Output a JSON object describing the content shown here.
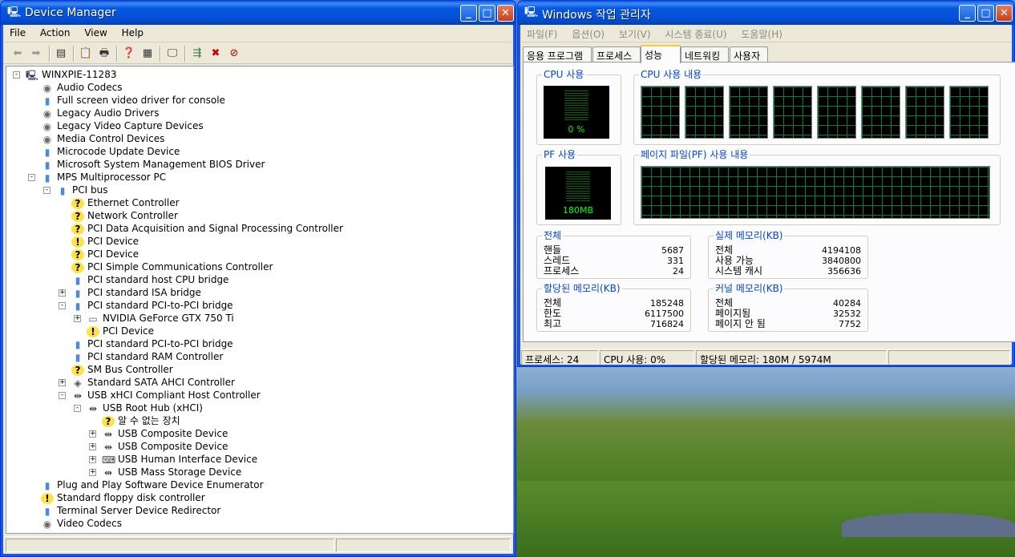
{
  "device_manager": {
    "title": "Device Manager",
    "menu": [
      "File",
      "Action",
      "View",
      "Help"
    ],
    "tree": [
      {
        "label": "WINXPIE-11283",
        "icon": "computer-icon",
        "depth": 0,
        "exp": "-"
      },
      {
        "label": "Audio Codecs",
        "icon": "codec-icon",
        "depth": 1,
        "exp": ""
      },
      {
        "label": "Full screen video driver for console",
        "icon": "device-icon",
        "depth": 1,
        "exp": ""
      },
      {
        "label": "Legacy Audio Drivers",
        "icon": "codec-icon",
        "depth": 1,
        "exp": ""
      },
      {
        "label": "Legacy Video Capture Devices",
        "icon": "codec-icon",
        "depth": 1,
        "exp": ""
      },
      {
        "label": "Media Control Devices",
        "icon": "codec-icon",
        "depth": 1,
        "exp": ""
      },
      {
        "label": "Microcode Update Device",
        "icon": "device-icon",
        "depth": 1,
        "exp": ""
      },
      {
        "label": "Microsoft System Management BIOS Driver",
        "icon": "device-icon",
        "depth": 1,
        "exp": ""
      },
      {
        "label": "MPS Multiprocessor PC",
        "icon": "device-icon",
        "depth": 1,
        "exp": "-"
      },
      {
        "label": "PCI bus",
        "icon": "device-icon",
        "depth": 2,
        "exp": "-"
      },
      {
        "label": "Ethernet Controller",
        "icon": "unknown-device-icon",
        "depth": 3,
        "exp": ""
      },
      {
        "label": "Network Controller",
        "icon": "unknown-device-icon",
        "depth": 3,
        "exp": ""
      },
      {
        "label": "PCI Data Acquisition and Signal Processing Controller",
        "icon": "unknown-device-icon",
        "depth": 3,
        "exp": ""
      },
      {
        "label": "PCI Device",
        "icon": "warning-device-icon",
        "depth": 3,
        "exp": ""
      },
      {
        "label": "PCI Device",
        "icon": "unknown-device-icon",
        "depth": 3,
        "exp": ""
      },
      {
        "label": "PCI Simple Communications Controller",
        "icon": "unknown-device-icon",
        "depth": 3,
        "exp": ""
      },
      {
        "label": "PCI standard host CPU bridge",
        "icon": "device-icon",
        "depth": 3,
        "exp": ""
      },
      {
        "label": "PCI standard ISA bridge",
        "icon": "device-icon",
        "depth": 3,
        "exp": "+"
      },
      {
        "label": "PCI standard PCI-to-PCI bridge",
        "icon": "device-icon",
        "depth": 3,
        "exp": "-"
      },
      {
        "label": "NVIDIA GeForce GTX 750 Ti",
        "icon": "display-icon",
        "depth": 4,
        "exp": "+"
      },
      {
        "label": "PCI Device",
        "icon": "warning-device-icon",
        "depth": 4,
        "exp": ""
      },
      {
        "label": "PCI standard PCI-to-PCI bridge",
        "icon": "device-icon",
        "depth": 3,
        "exp": ""
      },
      {
        "label": "PCI standard RAM Controller",
        "icon": "device-icon",
        "depth": 3,
        "exp": ""
      },
      {
        "label": "SM Bus Controller",
        "icon": "unknown-device-icon",
        "depth": 3,
        "exp": ""
      },
      {
        "label": "Standard SATA AHCI Controller",
        "icon": "ide-icon",
        "depth": 3,
        "exp": "+"
      },
      {
        "label": "USB xHCI Compliant Host Controller",
        "icon": "usb-icon",
        "depth": 3,
        "exp": "-"
      },
      {
        "label": "USB Root Hub (xHCI)",
        "icon": "usb-icon",
        "depth": 4,
        "exp": "-"
      },
      {
        "label": "알 수 없는 장치",
        "icon": "unknown-device-icon",
        "depth": 5,
        "exp": ""
      },
      {
        "label": "USB Composite Device",
        "icon": "usb-icon",
        "depth": 5,
        "exp": "+"
      },
      {
        "label": "USB Composite Device",
        "icon": "usb-icon",
        "depth": 5,
        "exp": "+"
      },
      {
        "label": "USB Human Interface Device",
        "icon": "keyboard-icon",
        "depth": 5,
        "exp": "+"
      },
      {
        "label": "USB Mass Storage Device",
        "icon": "usb-icon",
        "depth": 5,
        "exp": "+"
      },
      {
        "label": "Plug and Play Software Device Enumerator",
        "icon": "device-icon",
        "depth": 1,
        "exp": ""
      },
      {
        "label": "Standard floppy disk controller",
        "icon": "warning-device-icon",
        "depth": 1,
        "exp": ""
      },
      {
        "label": "Terminal Server Device Redirector",
        "icon": "device-icon",
        "depth": 1,
        "exp": ""
      },
      {
        "label": "Video Codecs",
        "icon": "codec-icon",
        "depth": 1,
        "exp": ""
      }
    ]
  },
  "task_manager": {
    "title": "Windows 작업 관리자",
    "menu": [
      "파일(F)",
      "옵션(O)",
      "보기(V)",
      "시스템 종료(U)",
      "도움말(H)"
    ],
    "tabs": [
      "응용 프로그램",
      "프로세스",
      "성능",
      "네트워킹",
      "사용자"
    ],
    "active_tab": "성능",
    "cpu_usage_label": "CPU 사용",
    "cpu_usage_value": "0 %",
    "cpu_history_label": "CPU 사용 내용",
    "pf_usage_label": "PF 사용",
    "pf_usage_value": "180MB",
    "pf_history_label": "페이지 파일(PF) 사용 내용",
    "totals": {
      "label": "전체",
      "rows": [
        [
          "핸들",
          "5687"
        ],
        [
          "스레드",
          "331"
        ],
        [
          "프로세스",
          "24"
        ]
      ]
    },
    "physical": {
      "label": "실제 메모리(KB)",
      "rows": [
        [
          "전체",
          "4194108"
        ],
        [
          "사용 가능",
          "3840800"
        ],
        [
          "시스템 캐시",
          "356636"
        ]
      ]
    },
    "commit": {
      "label": "할당된 메모리(KB)",
      "rows": [
        [
          "전체",
          "185248"
        ],
        [
          "한도",
          "6117500"
        ],
        [
          "최고",
          "716824"
        ]
      ]
    },
    "kernel": {
      "label": "커널 메모리(KB)",
      "rows": [
        [
          "전체",
          "40284"
        ],
        [
          "페이지됨",
          "32532"
        ],
        [
          "페이지 안 됨",
          "7752"
        ]
      ]
    },
    "status": {
      "processes": "프로세스: 24",
      "cpu": "CPU 사용: 0%",
      "commit": "할당된 메모리: 180M / 5974M"
    }
  }
}
